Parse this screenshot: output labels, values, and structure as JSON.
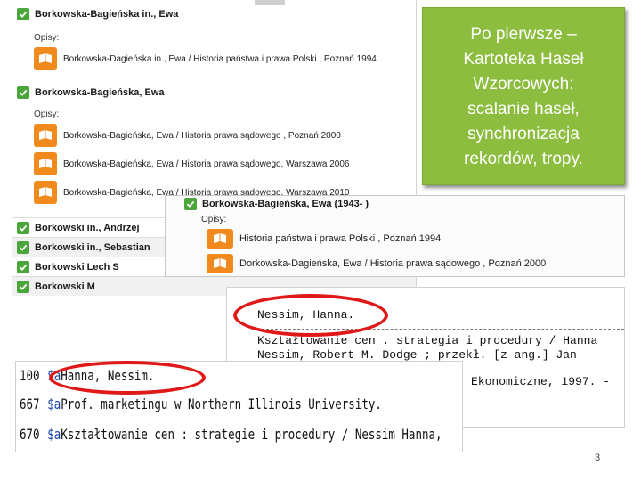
{
  "panel_main": {
    "record_1": {
      "heading": "Borkowska-Bagieńska in., Ewa"
    },
    "opisy_label": "Opisy:",
    "record_1_descriptions": [
      "Borkowska-Dagieńska in., Ewa / Historia państwa i prawa Polski , Poznań 1994"
    ],
    "record_2": {
      "heading": "Borkowska-Bagieńska, Ewa"
    },
    "record_2_descriptions": [
      "Borkowska-Bagieńska, Ewa / Historia prawa sądowego , Poznań 2000",
      "Borkowska-Bagieńska, Ewa / Historia prawa sądowego, Warszawa 2006",
      "Borkowska-Bagieńska, Ewa / Historia prawa sądowego, Warszawa 2010"
    ],
    "list_rows": [
      "Borkowski in., Andrzej",
      "Borkowski in., Sebastian",
      "Borkowski Lech S",
      "Borkowski M"
    ]
  },
  "panel_second": {
    "heading": "Borkowska-Bagieńska, Ewa (1943- )",
    "opisy_label": "Opisy:",
    "descriptions": [
      "Historia państwa i prawa Polski , Poznań 1994",
      "Dorkowska-Dagieńska, Ewa / Historia prawa sądowego , Poznań 2000"
    ]
  },
  "slide_box": {
    "lines": [
      "Po pierwsze –",
      "Kartoteka Haseł",
      "Wzorcowych:",
      "scalanie haseł,",
      "synchronizacja",
      "rekordów, tropy."
    ]
  },
  "opac_snippet": {
    "heading": "Nessim, Hanna.",
    "lines": [
      "Kształtowanie cen . strategia i procedury / Hanna",
      "Nessim, Robert M. Dodge ; przekł. [z ang.] Jan",
      "Ekonomiczne, 1997. -"
    ]
  },
  "marc_snippet": {
    "rows": [
      {
        "tag": "100",
        "sub": "$a",
        "value": "Hanna, Nessim."
      },
      {
        "tag": "667",
        "sub": "$a",
        "value": "Prof. marketingu w Northern Illinois University."
      },
      {
        "tag": "670",
        "sub": "$a",
        "value": "Kształtowanie cen : strategie i procedury / Nessim Hanna,"
      }
    ]
  },
  "page_number": "3",
  "colors": {
    "check_green": "#4aa53a",
    "book_orange": "#f08a1c",
    "slide_green": "#8cbd3e",
    "highlight_red": "#e01818"
  },
  "icons": {
    "check": "check-icon",
    "book": "book-icon"
  }
}
